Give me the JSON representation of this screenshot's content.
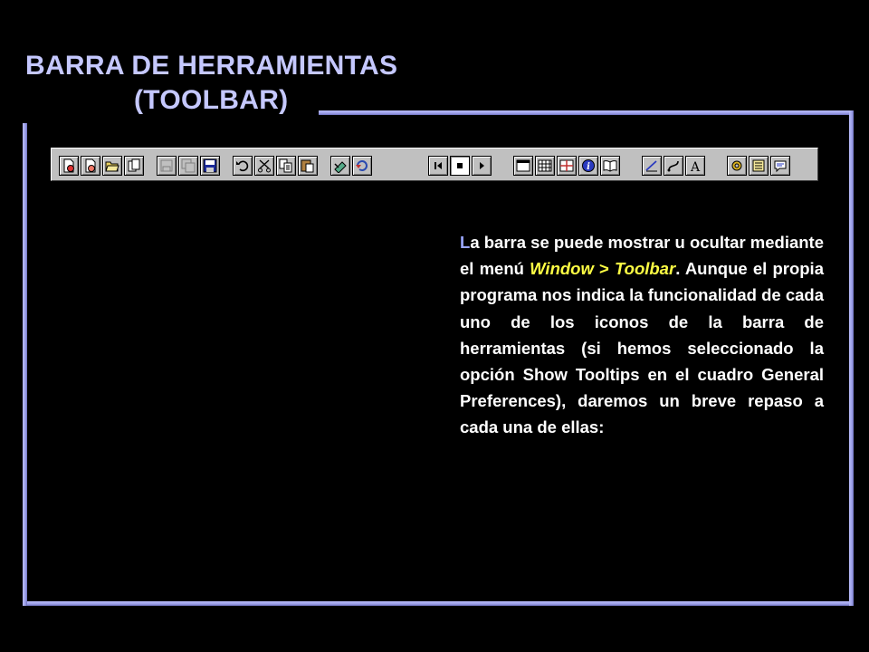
{
  "slide": {
    "title_line1": "BARRA DE HERRAMIENTAS",
    "title_line2": "(TOOLBAR)"
  },
  "body": {
    "first_letter": "L",
    "part1": "a barra se puede mostrar u ocultar mediante el menú ",
    "menu_window": "Window",
    "gt": " > ",
    "menu_toolbar": "Toolbar",
    "part2": ". Aunque el propia programa nos indica la funcionalidad de cada uno de los iconos de la barra de herramientas (si hemos seleccionado la opción Show Tooltips en el cuadro General Preferences), daremos un breve repaso a cada una de ellas:"
  },
  "toolbar": {
    "buttons": [
      {
        "icon": "new-story-icon"
      },
      {
        "icon": "new-file-icon"
      },
      {
        "icon": "open-folder-icon"
      },
      {
        "icon": "copy-page-icon"
      },
      {
        "icon": "save-gray-icon"
      },
      {
        "icon": "save-all-gray-icon"
      },
      {
        "icon": "save-icon"
      },
      {
        "icon": "undo-icon"
      },
      {
        "icon": "cut-icon"
      },
      {
        "icon": "copy-icon"
      },
      {
        "icon": "paste-icon"
      },
      {
        "icon": "check-syntax-icon"
      },
      {
        "icon": "replay-icon"
      },
      {
        "icon": "rewind-icon"
      },
      {
        "icon": "stop-icon"
      },
      {
        "icon": "play-icon"
      },
      {
        "icon": "window-icon"
      },
      {
        "icon": "grid-icon"
      },
      {
        "icon": "crosshair-icon"
      },
      {
        "icon": "info-icon"
      },
      {
        "icon": "book-icon"
      },
      {
        "icon": "line-icon"
      },
      {
        "icon": "curve-icon"
      },
      {
        "icon": "text-icon"
      },
      {
        "icon": "gear-icon"
      },
      {
        "icon": "document-icon"
      },
      {
        "icon": "comment-icon"
      }
    ]
  },
  "colors": {
    "title": "#c5c8ff",
    "frame": "#9da0e8",
    "highlight_letter": "#9aa6ff",
    "menu_highlight": "#ffff44"
  }
}
